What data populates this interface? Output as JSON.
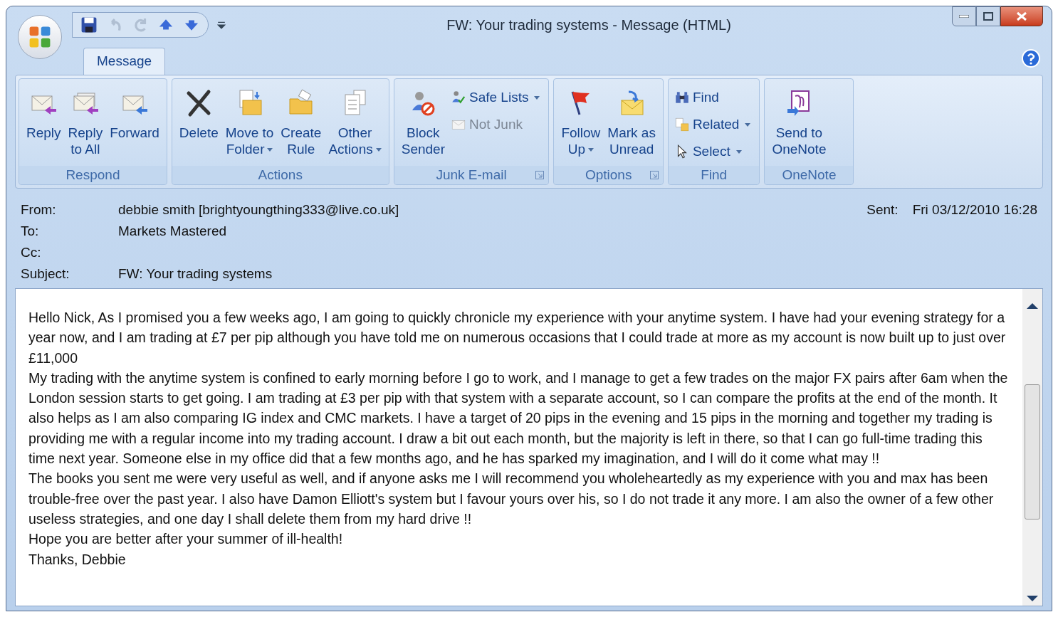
{
  "window": {
    "title": "FW: Your trading systems - Message (HTML)"
  },
  "quick_access": [
    {
      "disabled": false
    },
    {
      "disabled": true
    },
    {
      "disabled": true
    },
    {
      "disabled": false
    },
    {
      "disabled": false
    }
  ],
  "tabs": [
    {
      "label": "Message",
      "selected": true
    }
  ],
  "ribbon": {
    "groups": [
      {
        "label": "Respond",
        "launcher": false,
        "items": [
          {
            "kind": "large",
            "lines": [
              "Reply"
            ],
            "dropdown": false,
            "disabled": false
          },
          {
            "kind": "large",
            "lines": [
              "Reply",
              "to All"
            ],
            "dropdown": false,
            "disabled": false
          },
          {
            "kind": "large",
            "lines": [
              "Forward"
            ],
            "dropdown": false,
            "disabled": false
          }
        ]
      },
      {
        "label": "Actions",
        "launcher": false,
        "items": [
          {
            "kind": "large",
            "lines": [
              "Delete"
            ],
            "dropdown": false,
            "disabled": false
          },
          {
            "kind": "large",
            "lines": [
              "Move to",
              "Folder"
            ],
            "dropdown": true,
            "disabled": false
          },
          {
            "kind": "large",
            "lines": [
              "Create",
              "Rule"
            ],
            "dropdown": false,
            "disabled": false
          },
          {
            "kind": "large",
            "lines": [
              "Other",
              "Actions"
            ],
            "dropdown": true,
            "disabled": false
          }
        ]
      },
      {
        "label": "Junk E-mail",
        "launcher": true,
        "items": [
          {
            "kind": "large",
            "lines": [
              "Block",
              "Sender"
            ],
            "dropdown": false,
            "disabled": false
          },
          {
            "kind": "small",
            "lines": [
              "Safe Lists"
            ],
            "dropdown": true,
            "disabled": false
          },
          {
            "kind": "small",
            "lines": [
              "Not Junk"
            ],
            "dropdown": false,
            "disabled": true
          }
        ]
      },
      {
        "label": "Options",
        "launcher": true,
        "items": [
          {
            "kind": "large",
            "lines": [
              "Follow",
              "Up"
            ],
            "dropdown": true,
            "disabled": false
          },
          {
            "kind": "large",
            "lines": [
              "Mark as",
              "Unread"
            ],
            "dropdown": false,
            "disabled": false
          }
        ]
      },
      {
        "label": "Find",
        "launcher": false,
        "items": [
          {
            "kind": "small",
            "lines": [
              "Find"
            ],
            "dropdown": false,
            "disabled": false
          },
          {
            "kind": "small",
            "lines": [
              "Related"
            ],
            "dropdown": true,
            "disabled": false
          },
          {
            "kind": "small",
            "lines": [
              "Select"
            ],
            "dropdown": true,
            "disabled": false
          }
        ]
      },
      {
        "label": "OneNote",
        "launcher": false,
        "items": [
          {
            "kind": "large",
            "lines": [
              "Send to",
              "OneNote"
            ],
            "dropdown": false,
            "disabled": false
          }
        ]
      }
    ]
  },
  "header": {
    "fields": [
      {
        "label": "From:",
        "value": "debbie smith [brightyoungthing333@live.co.uk]"
      },
      {
        "label": "To:",
        "value": "Markets Mastered"
      },
      {
        "label": "Cc:"
      },
      {
        "label": "Subject:",
        "value": "FW: Your trading systems"
      }
    ],
    "sent": {
      "label": "Sent:",
      "value": "Fri 03/12/2010 16:28"
    }
  },
  "body": {
    "paragraphs": [
      "Hello Nick, As I promised you a few weeks ago, I am going to quickly chronicle my experience with your anytime system. I have had your evening strategy for a year now, and I am trading at £7 per pip although you have told me on numerous occasions that I could trade at more as my account is now built up to just over £11,000",
      "My trading with the anytime system is confined to early morning before I go to work, and I manage to get a few trades on the major FX pairs after 6am when the London session starts to get going. I am trading at £3 per pip with that system with a separate account, so I can compare the profits at the end of the month. It also helps as I am also comparing IG index and CMC markets. I have a target of 20 pips in the evening and 15 pips in the morning and together my trading is providing me with a regular income into my trading account. I draw a bit out each month, but the majority is left in there, so that I can go full-time trading this time next year. Someone else in my office did that a few months ago, and he has sparked my imagination, and I will do it come what may !!",
      "The books you sent me were very useful as well, and if anyone asks me I will recommend you wholeheartedly as my experience with you and max has been trouble-free over the past year. I also have Damon Elliott's system but I favour yours over his, so I do not trade it any more. I am also the owner of a few other useless strategies, and one day I shall delete them from my hard drive !!",
      "Hope you are better after your summer of ill-health!",
      "Thanks, Debbie"
    ]
  }
}
